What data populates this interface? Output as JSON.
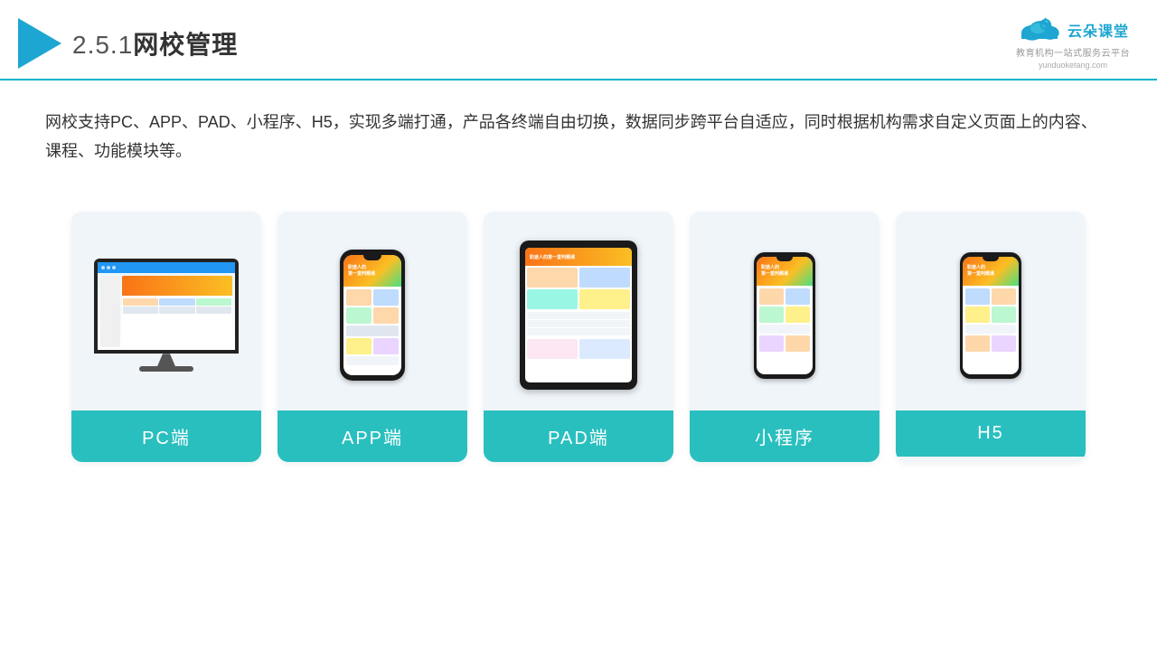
{
  "header": {
    "section_number": "2.5.1",
    "title": "网校管理",
    "brand_name": "云朵课堂",
    "brand_url": "yunduoketang.com",
    "brand_tagline": "教育机构一站式服务云平台"
  },
  "description": {
    "text": "网校支持PC、APP、PAD、小程序、H5，实现多端打通，产品各终端自由切换，数据同步跨平台自适应，同时根据机构需求自定义页面上的内容、课程、功能模块等。"
  },
  "cards": [
    {
      "id": "pc",
      "label": "PC端"
    },
    {
      "id": "app",
      "label": "APP端"
    },
    {
      "id": "pad",
      "label": "PAD端"
    },
    {
      "id": "miniprogram",
      "label": "小程序"
    },
    {
      "id": "h5",
      "label": "H5"
    }
  ],
  "colors": {
    "accent": "#2abfbf",
    "header_line": "#00b4c8",
    "card_bg": "#f0f5fa",
    "logo_blue": "#1da6d1"
  }
}
